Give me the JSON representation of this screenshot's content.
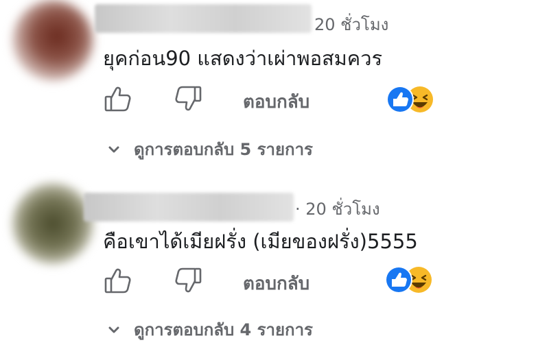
{
  "comments": [
    {
      "time": "20 ชั่วโมง",
      "text": "ยุคก่อน90 แสดงว่าเผ่าพอสมควร",
      "reply_label": "ตอบกลับ",
      "view_replies_label": "ดูการตอบกลับ 5 รายการ",
      "reactions": [
        "like-icon",
        "haha-icon"
      ]
    },
    {
      "time": "· 20 ชั่วโมง",
      "text": "คือเขาได้เมียฝรั่ง (เมียของฝรั่ง)5555",
      "reply_label": "ตอบกลับ",
      "view_replies_label": "ดูการตอบกลับ 4 รายการ",
      "reactions": [
        "like-icon",
        "haha-icon"
      ]
    }
  ],
  "colors": {
    "secondary_text": "#65676b",
    "like_blue": "#1877f2",
    "haha_yellow": "#f7b928"
  }
}
